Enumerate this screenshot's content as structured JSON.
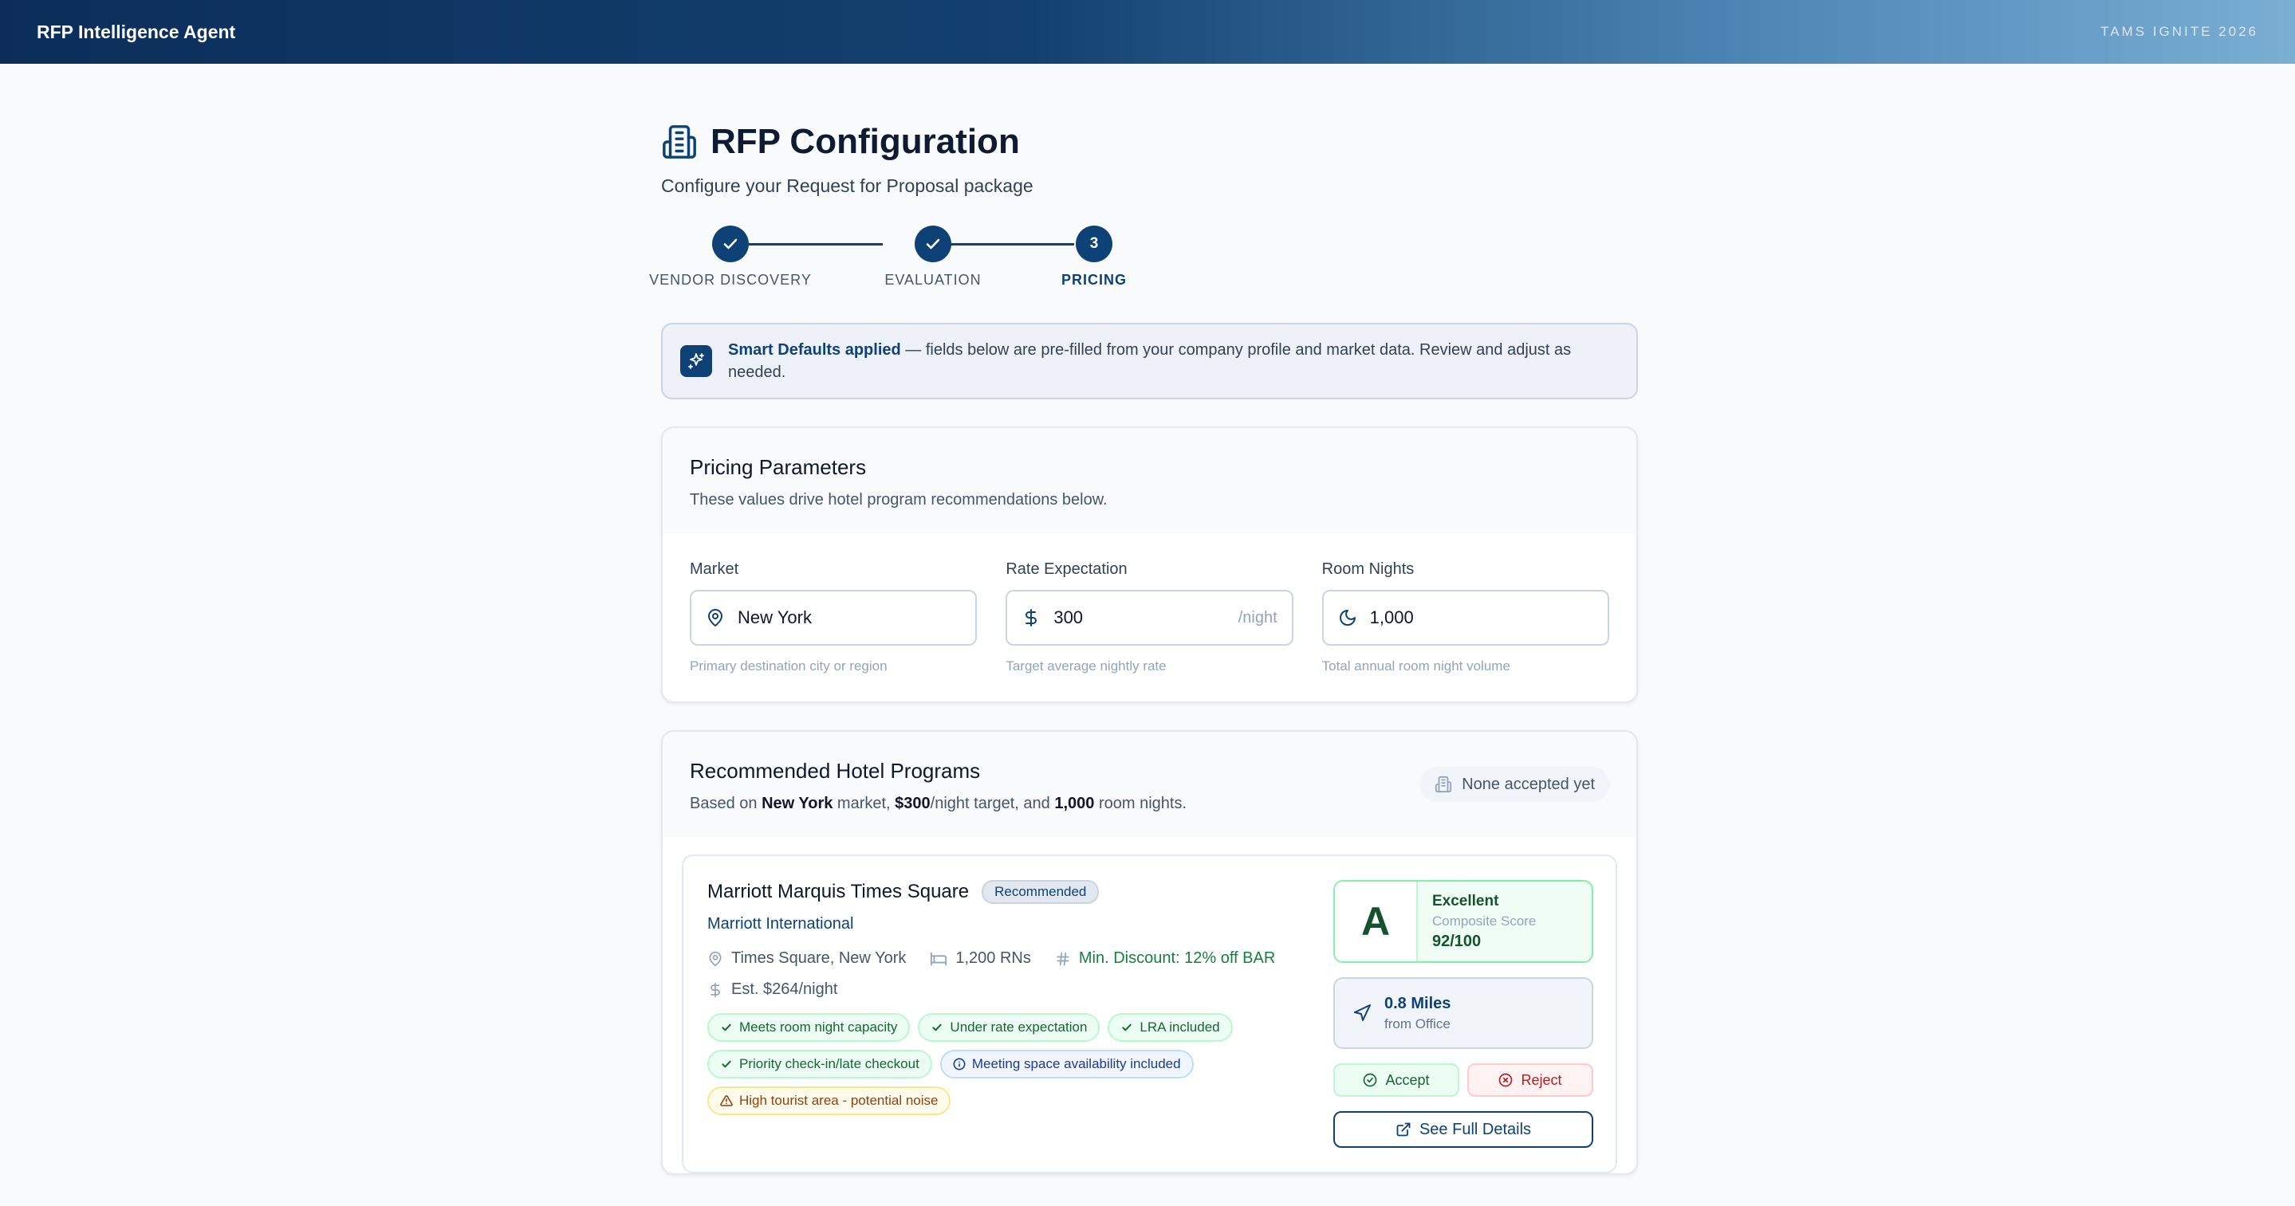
{
  "header": {
    "brand": "RFP Intelligence Agent",
    "event": "TAMS IGNITE 2026"
  },
  "page": {
    "title": "RFP Configuration",
    "subtitle": "Configure your Request for Proposal package"
  },
  "steps": [
    {
      "label": "VENDOR DISCOVERY",
      "status": "done"
    },
    {
      "label": "EVALUATION",
      "status": "done"
    },
    {
      "label": "PRICING",
      "status": "active",
      "number": "3"
    }
  ],
  "smart_defaults": {
    "strong": "Smart Defaults applied",
    "rest": " — fields below are pre-filled from your company profile and market data. Review and adjust as needed."
  },
  "pricing": {
    "title": "Pricing Parameters",
    "subtitle": "These values drive hotel program recommendations below.",
    "market": {
      "label": "Market",
      "value": "New York",
      "hint": "Primary destination city or region",
      "icon": "map-pin-icon"
    },
    "rate": {
      "label": "Rate Expectation",
      "value": "300",
      "suffix": "/night",
      "hint": "Target average nightly rate",
      "icon": "dollar-icon"
    },
    "nights": {
      "label": "Room Nights",
      "value": "1,000",
      "hint": "Total annual room night volume",
      "icon": "moon-icon"
    }
  },
  "programs": {
    "title": "Recommended Hotel Programs",
    "based_prefix": "Based on ",
    "market": "New York",
    "mid1": " market, ",
    "rate": "$300",
    "mid2": "/night target, and ",
    "nights": "1,000",
    "suffix": " room nights.",
    "accepted_status": "None accepted yet"
  },
  "hotel": {
    "name": "Marriott Marquis Times Square",
    "badge": "Recommended",
    "brand": "Marriott International",
    "location": "Times Square, New York",
    "rns": "1,200 RNs",
    "discount": "Min. Discount: 12% off BAR",
    "est": "Est. $264/night",
    "tags": {
      "t1": "Meets room night capacity",
      "t2": "Under rate expectation",
      "t3": "LRA included",
      "t4": "Priority check-in/late checkout",
      "t5": "Meeting space availability included",
      "t6": "High tourist area - potential noise"
    },
    "grade": "A",
    "grade_label": "Excellent",
    "score_label": "Composite Score",
    "score": "92/100",
    "distance": "0.8 Miles",
    "distance_from": "from Office",
    "accept": "Accept",
    "reject": "Reject",
    "details": "See Full Details"
  },
  "colors": {
    "primary": "#0e4276",
    "success": "#166534",
    "danger": "#b91c1c",
    "warning": "#92400e"
  }
}
